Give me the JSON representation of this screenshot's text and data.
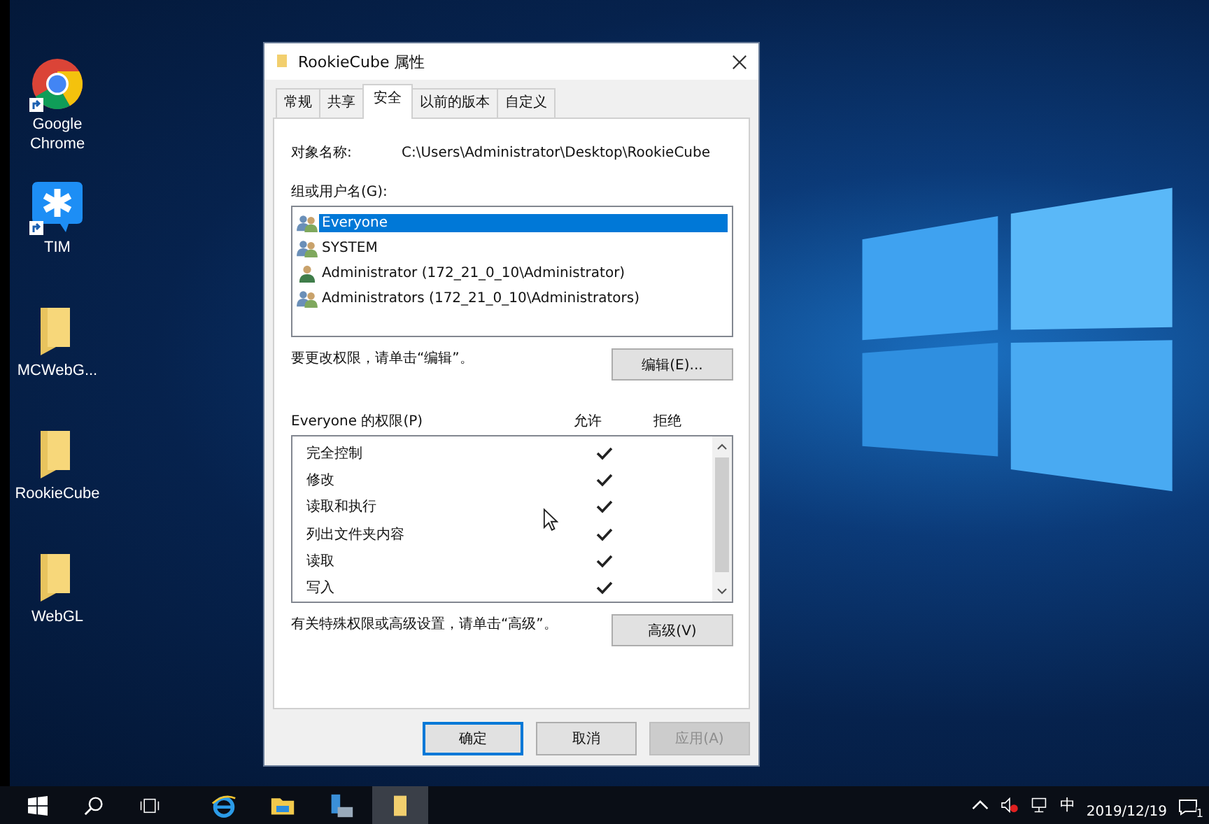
{
  "desktop_icons": [
    {
      "label": "Google Chrome",
      "kind": "chrome",
      "shortcut": true
    },
    {
      "label": "TIM",
      "kind": "tim",
      "shortcut": true
    },
    {
      "label": "MCWebG...",
      "kind": "folder",
      "shortcut": false
    },
    {
      "label": "RookieCube",
      "kind": "folder",
      "shortcut": false
    },
    {
      "label": "WebGL",
      "kind": "folder",
      "shortcut": false
    }
  ],
  "dialog": {
    "title": "RookieCube 属性",
    "tabs": [
      {
        "label": "常规",
        "selected": false
      },
      {
        "label": "共享",
        "selected": false
      },
      {
        "label": "安全",
        "selected": true
      },
      {
        "label": "以前的版本",
        "selected": false
      },
      {
        "label": "自定义",
        "selected": false
      }
    ],
    "object_name_label": "对象名称:",
    "object_name": "C:\\Users\\Administrator\\Desktop\\RookieCube",
    "groups_label": "组或用户名(G):",
    "users": [
      {
        "name": "Everyone",
        "kind": "group",
        "selected": true
      },
      {
        "name": "SYSTEM",
        "kind": "group",
        "selected": false
      },
      {
        "name": "Administrator (172_21_0_10\\Administrator)",
        "kind": "user",
        "selected": false
      },
      {
        "name": "Administrators (172_21_0_10\\Administrators)",
        "kind": "group",
        "selected": false
      }
    ],
    "change_hint": "要更改权限，请单击“编辑”。",
    "edit_button": "编辑(E)...",
    "permissions_label": "Everyone 的权限(P)",
    "allow_header": "允许",
    "deny_header": "拒绝",
    "permissions": [
      {
        "name": "完全控制",
        "allow": true,
        "deny": false
      },
      {
        "name": "修改",
        "allow": true,
        "deny": false
      },
      {
        "name": "读取和执行",
        "allow": true,
        "deny": false
      },
      {
        "name": "列出文件夹内容",
        "allow": true,
        "deny": false
      },
      {
        "name": "读取",
        "allow": true,
        "deny": false
      },
      {
        "name": "写入",
        "allow": true,
        "deny": false
      }
    ],
    "special_hint": "有关特殊权限或高级设置，请单击“高级”。",
    "advanced_button": "高级(V)",
    "buttons": [
      {
        "label": "确定",
        "kind": "default",
        "disabled": false
      },
      {
        "label": "取消",
        "kind": "normal",
        "disabled": false
      },
      {
        "label": "应用(A)",
        "kind": "normal",
        "disabled": true
      }
    ]
  },
  "taskbar": {
    "apps": [
      {
        "kind": "ie",
        "active": false
      },
      {
        "kind": "explorer",
        "active": false
      },
      {
        "kind": "server",
        "active": false
      },
      {
        "kind": "folder",
        "active": true
      }
    ],
    "ime": "中",
    "date": "2019/12/19",
    "notification_count": "1"
  }
}
